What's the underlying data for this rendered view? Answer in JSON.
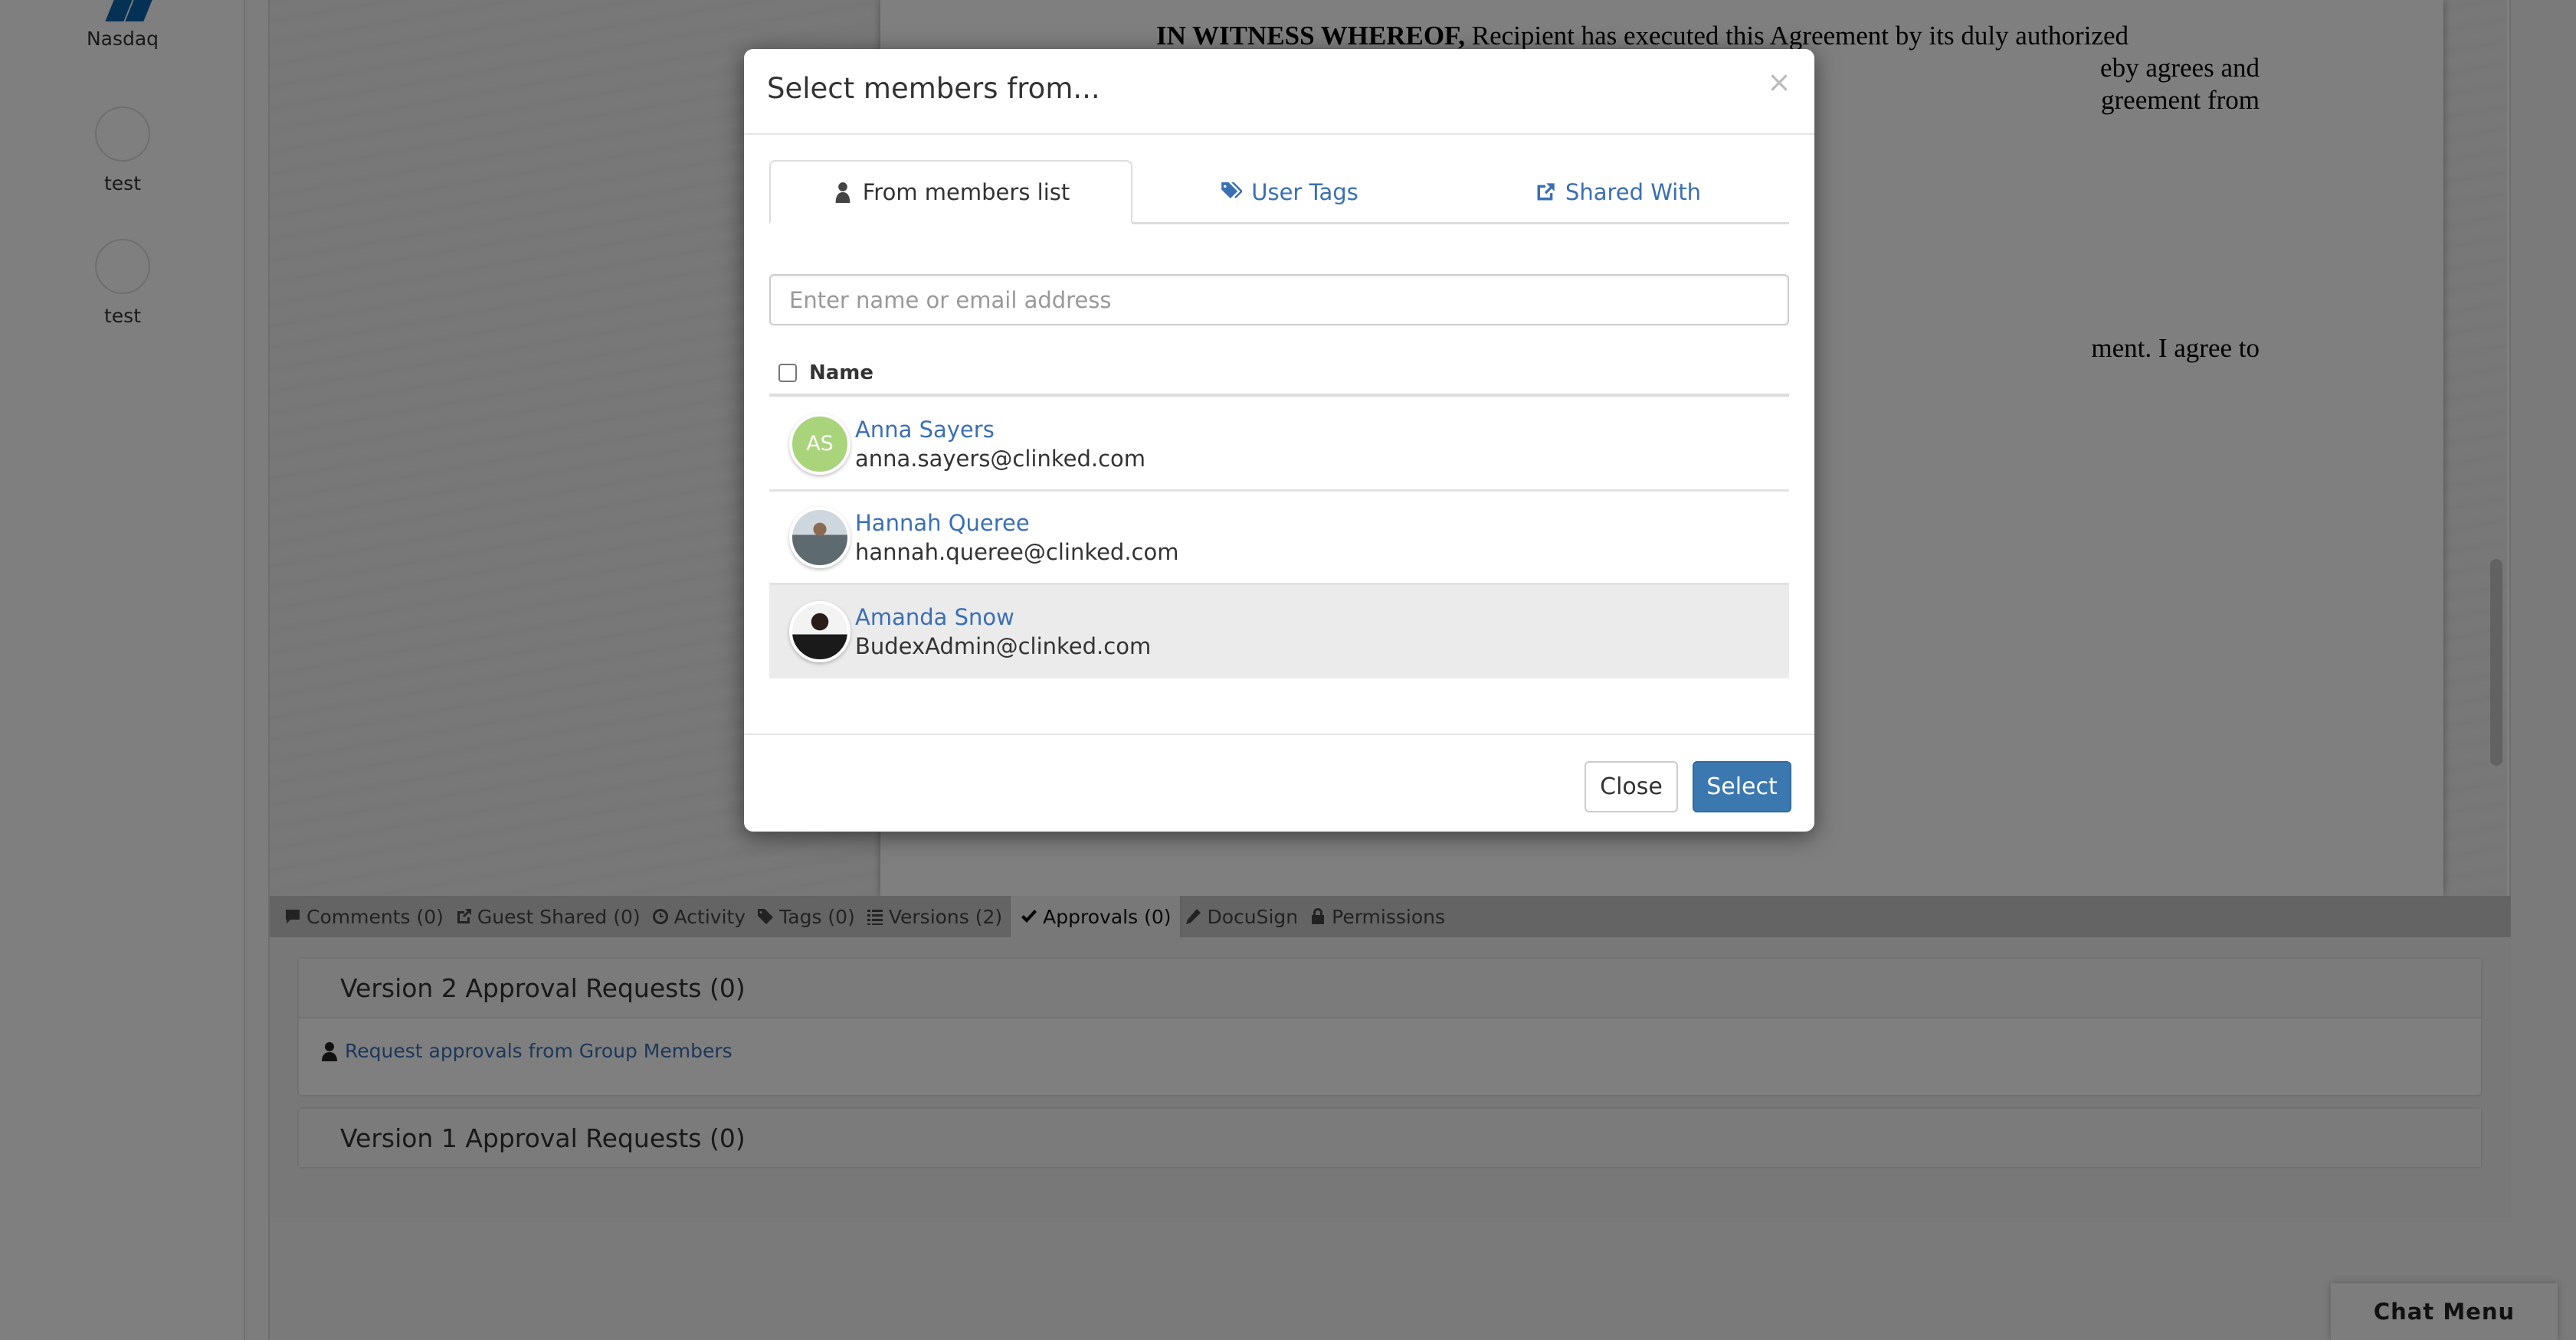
{
  "sidebar": {
    "items": [
      {
        "label": "Nasdaq",
        "icon": "nasdaq-logo"
      },
      {
        "label": "test",
        "icon": "empty-avatar-circle"
      },
      {
        "label": "test",
        "icon": "empty-avatar-circle"
      }
    ]
  },
  "document": {
    "paragraph_1": "IN WITNESS WHEREOF, Recipient has executed this Agreement by its duly authorized ... hereby agrees and ... Agreement from",
    "paragraph_1_bold": "IN WITNESS WHEREOF,",
    "paragraph_1_rest": " Recipient has executed this Agreement by its duly authorized",
    "line_2_tail": "eby agrees and",
    "line_3_tail": "greement from",
    "paragraph_2_tail": "ment. I agree to"
  },
  "tabs": [
    {
      "label": "Comments (0)",
      "icon": "comment-icon",
      "active": false
    },
    {
      "label": "Guest Shared (0)",
      "icon": "share-icon",
      "active": false
    },
    {
      "label": "Activity",
      "icon": "clock-icon",
      "active": false
    },
    {
      "label": "Tags (0)",
      "icon": "tag-icon",
      "active": false
    },
    {
      "label": "Versions (2)",
      "icon": "list-icon",
      "active": false
    },
    {
      "label": "Approvals (0)",
      "icon": "check-icon",
      "active": true
    },
    {
      "label": "DocuSign",
      "icon": "pencil-icon",
      "active": false
    },
    {
      "label": "Permissions",
      "icon": "lock-icon",
      "active": false
    }
  ],
  "approvals": {
    "panels": [
      {
        "title": "Version 2 Approval Requests (0)",
        "link": "Request approvals from Group Members"
      },
      {
        "title": "Version 1 Approval Requests (0)"
      }
    ]
  },
  "chat_menu": {
    "label": "Chat Menu"
  },
  "modal": {
    "title": "Select members from...",
    "close_glyph": "×",
    "tabs": [
      {
        "label": "From members list",
        "icon": "user-icon",
        "active": true
      },
      {
        "label": "User Tags",
        "icon": "tags-icon",
        "active": false
      },
      {
        "label": "Shared With",
        "icon": "share-icon",
        "active": false
      }
    ],
    "search": {
      "placeholder": "Enter name or email address",
      "value": ""
    },
    "list_header": "Name",
    "members": [
      {
        "name": "Anna Sayers",
        "email": "anna.sayers@clinked.com",
        "avatar": "AS",
        "highlighted": false
      },
      {
        "name": "Hannah Queree",
        "email": "hannah.queree@clinked.com",
        "avatar": "photo",
        "highlighted": false
      },
      {
        "name": "Amanda Snow",
        "email": "BudexAdmin@clinked.com",
        "avatar": "photo",
        "highlighted": true
      }
    ],
    "buttons": {
      "close": "Close",
      "select": "Select"
    }
  },
  "colors": {
    "accent": "#3c78b0",
    "link": "#3a6fb5",
    "avatar_initials_bg": "#a9d47b",
    "row_highlight": "#ebebeb"
  }
}
